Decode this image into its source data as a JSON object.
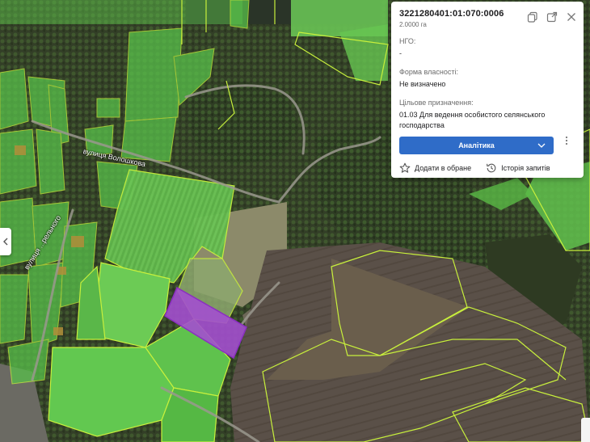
{
  "panel": {
    "parcel_id": "3221280401:01:070:0006",
    "area": "2.0000 га",
    "fields": [
      {
        "label": "НГО:",
        "value": "-"
      },
      {
        "label": "Форма власності:",
        "value": "Не визначено"
      },
      {
        "label": "Цільове призначення:",
        "value": "01.03 Для ведення особистого селянського господарства"
      }
    ],
    "analytics_button": "Аналітика",
    "add_favorite": "Додати в обране",
    "history": "Історія запитів"
  },
  "map": {
    "street_labels": [
      "вулиця Волошкова",
      "вулиця ...рельного"
    ],
    "colors": {
      "selected_parcel": "#a34fcf",
      "parcel_outline": "#c8f03c",
      "parcel_fill": "#5cc64a",
      "accent": "#2f6cc8"
    }
  }
}
